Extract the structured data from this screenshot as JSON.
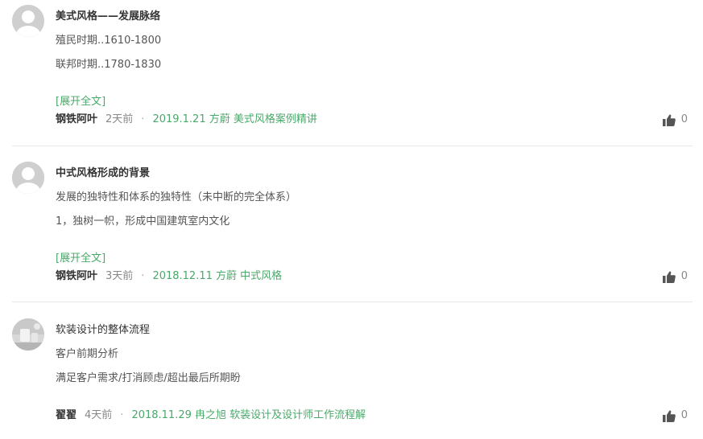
{
  "notes": [
    {
      "title": "美式风格——发展脉络",
      "lines": [
        "殖民时期..1610-1800",
        "联邦时期..1780-1830"
      ],
      "expand": "[展开全文]",
      "author": "钢铁阿叶",
      "time": "2天前",
      "separator": "·",
      "ref": "2019.1.21 方蔚 美式风格案例精讲",
      "likes": "0",
      "avatar": "default-avatar"
    },
    {
      "title": "中式风格形成的背景",
      "lines": [
        "发展的独特性和体系的独特性（未中断的完全体系）",
        "1，独树一帜，形成中国建筑室内文化"
      ],
      "expand": "[展开全文]",
      "author": "钢铁阿叶",
      "time": "3天前",
      "separator": "·",
      "ref": "2018.12.11 方蔚 中式风格",
      "likes": "0",
      "avatar": "default-avatar"
    },
    {
      "title": "软装设计的整体流程",
      "lines": [
        "客户前期分析",
        "满足客户需求/打消顾虑/超出最后所期盼"
      ],
      "author": "翟翟",
      "time": "4天前",
      "separator": "·",
      "ref": "2018.11.29 冉之旭 软装设计及设计师工作流程解",
      "likes": "0",
      "avatar": "photo-avatar"
    }
  ],
  "icons": {
    "like": "thumbs-up-icon",
    "avatar_default": "user-silhouette-icon"
  },
  "colors": {
    "link_green": "#4aa86a",
    "text": "#333333",
    "muted": "#888888",
    "divider": "#e8e8e8"
  }
}
